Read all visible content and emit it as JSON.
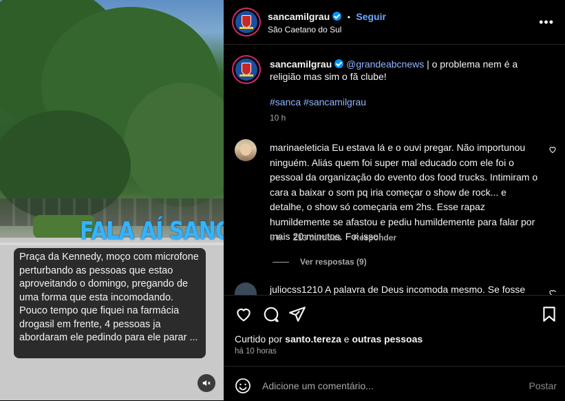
{
  "media": {
    "overlay_title": "FALA AÍ SANCA",
    "caption_text": "Praça da Kennedy, moço com microfone perturbando as pessoas que estao aproveitando o domingo, pregando de uma forma que esta incomodando. Pouco tempo que fiquei na farmácia drogasil em frente, 4 pessoas ja abordaram ele pedindo para ele parar ...",
    "mute_icon": "speaker-muted-icon"
  },
  "header": {
    "username": "sancamilgrau",
    "dot": "•",
    "follow_label": "Seguir",
    "location": "São Caetano do Sul",
    "more_icon": "more-options-icon"
  },
  "post": {
    "username": "sancamilgrau",
    "mention": "@grandeabcnews",
    "text": " | o problema nem é a religião mas sim o fã clube!",
    "hashtags": "#sanca #sancamilgrau",
    "time": "10 h"
  },
  "comments": [
    {
      "username": "marinaeleticia",
      "text": " Eu estava lá e o ouvi pregar. Não importunou ninguém. Aliás quem foi super mal educado com ele foi o pessoal da organização do evento dos food trucks. Intimiram o cara a baixar o som pq iria começar o show de rock... e detalhe, o show só começaria em 2hs. Esse rapaz humildemente se afastou e pediu humildemente para falar por mais 20 minutos. Foi isso!",
      "time": "9 h",
      "likes": "213 curtidas",
      "reply_label": "Responder",
      "view_replies": "Ver respostas (9)"
    },
    {
      "username": "juliocss1210",
      "text": " A palavra de Deus incomoda mesmo. Se fosse"
    }
  ],
  "footer": {
    "liked_prefix": "Curtido por ",
    "liked_user": "santo.tereza",
    "liked_mid": " e ",
    "liked_others": "outras pessoas",
    "ago": "há 10 horas",
    "comment_placeholder": "Adicione um comentário...",
    "post_label": "Postar"
  }
}
